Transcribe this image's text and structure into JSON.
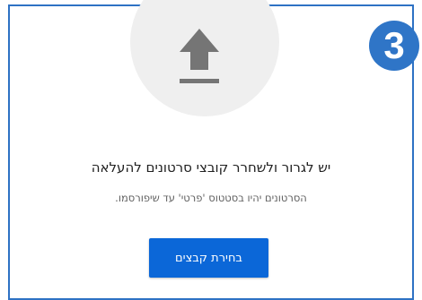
{
  "dialog": {
    "title": "יש לגרור ולשחרר קובצי סרטונים להעלאה",
    "subtitle": "הסרטונים יהיו בסטטוס 'פרטי' עד שיפורסמו.",
    "select_button_label": "בחירת קבצים"
  },
  "step_badge": {
    "number": "3"
  },
  "icons": {
    "upload": "upload-arrow-icon"
  },
  "colors": {
    "accent": "#0b67d8",
    "badge": "#2f75c7",
    "frame_border": "#2e72c4",
    "icon_fill": "#757575",
    "circle_bg": "#efefef"
  }
}
